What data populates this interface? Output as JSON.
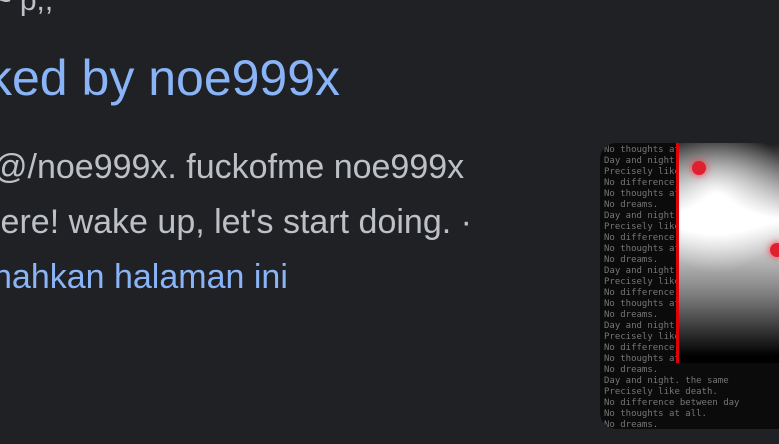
{
  "result": {
    "title_visible": "ked by noe999x",
    "snippet_line1": "@/noe999x. fuckofme noe999x",
    "snippet_line2": "lere! wake up, let's start doing. ·",
    "translate_link": "nahkan halaman ini"
  },
  "thumbnail": {
    "text_lines": [
      "No thoughts at all.",
      "Day and night. the same",
      "Precisely like death.",
      "No difference between day",
      "No thoughts at all.",
      "No dreams.",
      "Day and night. the same",
      "Precisely like death.",
      "No difference between day",
      "No thoughts at all.",
      "No dreams.",
      "Day and night. the same",
      "Precisely like death.",
      "No difference between day",
      "No thoughts at all.",
      "No dreams.",
      "Day and night. the same",
      "Precisely like death.",
      "No difference between day",
      "No thoughts at all.",
      "No dreams.",
      "Day and night. the same",
      "Precisely like death.",
      "No difference between day",
      "No thoughts at all.",
      "No dreams."
    ]
  },
  "colors": {
    "background": "#202124",
    "link": "#8ab4f8",
    "text": "#bdc1c6",
    "accent_red": "#c41e2a"
  }
}
